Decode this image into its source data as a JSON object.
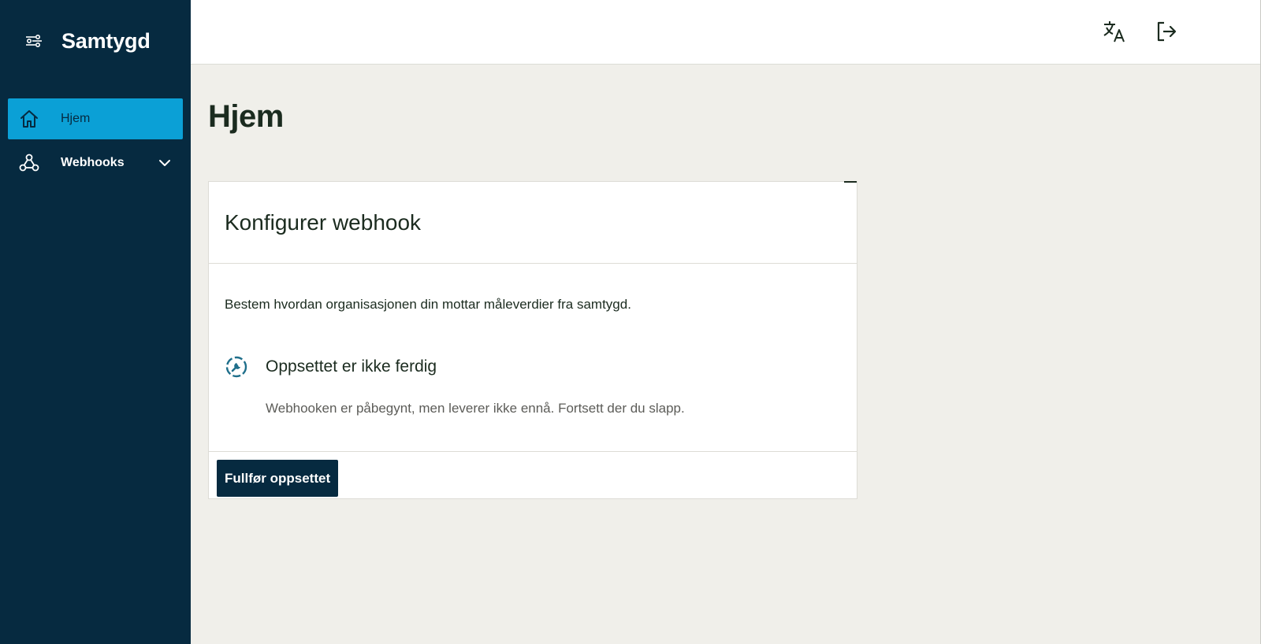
{
  "app": {
    "brand": "Samtygd"
  },
  "sidebar": {
    "items": [
      {
        "label": "Hjem",
        "icon": "home-icon",
        "active": true
      },
      {
        "label": "Webhooks",
        "icon": "webhook-icon",
        "active": false,
        "expandable": true
      }
    ]
  },
  "topbar": {
    "actions": [
      {
        "name": "translate-icon"
      },
      {
        "name": "logout-icon"
      }
    ]
  },
  "main": {
    "title": "Hjem",
    "card": {
      "title": "Konfigurer webhook",
      "description": "Bestem hvordan organisasjonen din mottar måleverdier fra samtygd.",
      "status": {
        "title": "Oppsettet er ikke ferdig",
        "text": "Webhooken er påbegynt, men leverer ikke ennå. Fortsett der du slapp.",
        "icon": "setup-incomplete-icon"
      },
      "action_label": "Fullfør oppsettet"
    }
  },
  "colors": {
    "sidebar_bg": "#062a40",
    "active_nav_bg": "#0ba0d6",
    "page_bg": "#f0efea",
    "status_icon": "#1f6f8b",
    "primary_button": "#062a40"
  }
}
